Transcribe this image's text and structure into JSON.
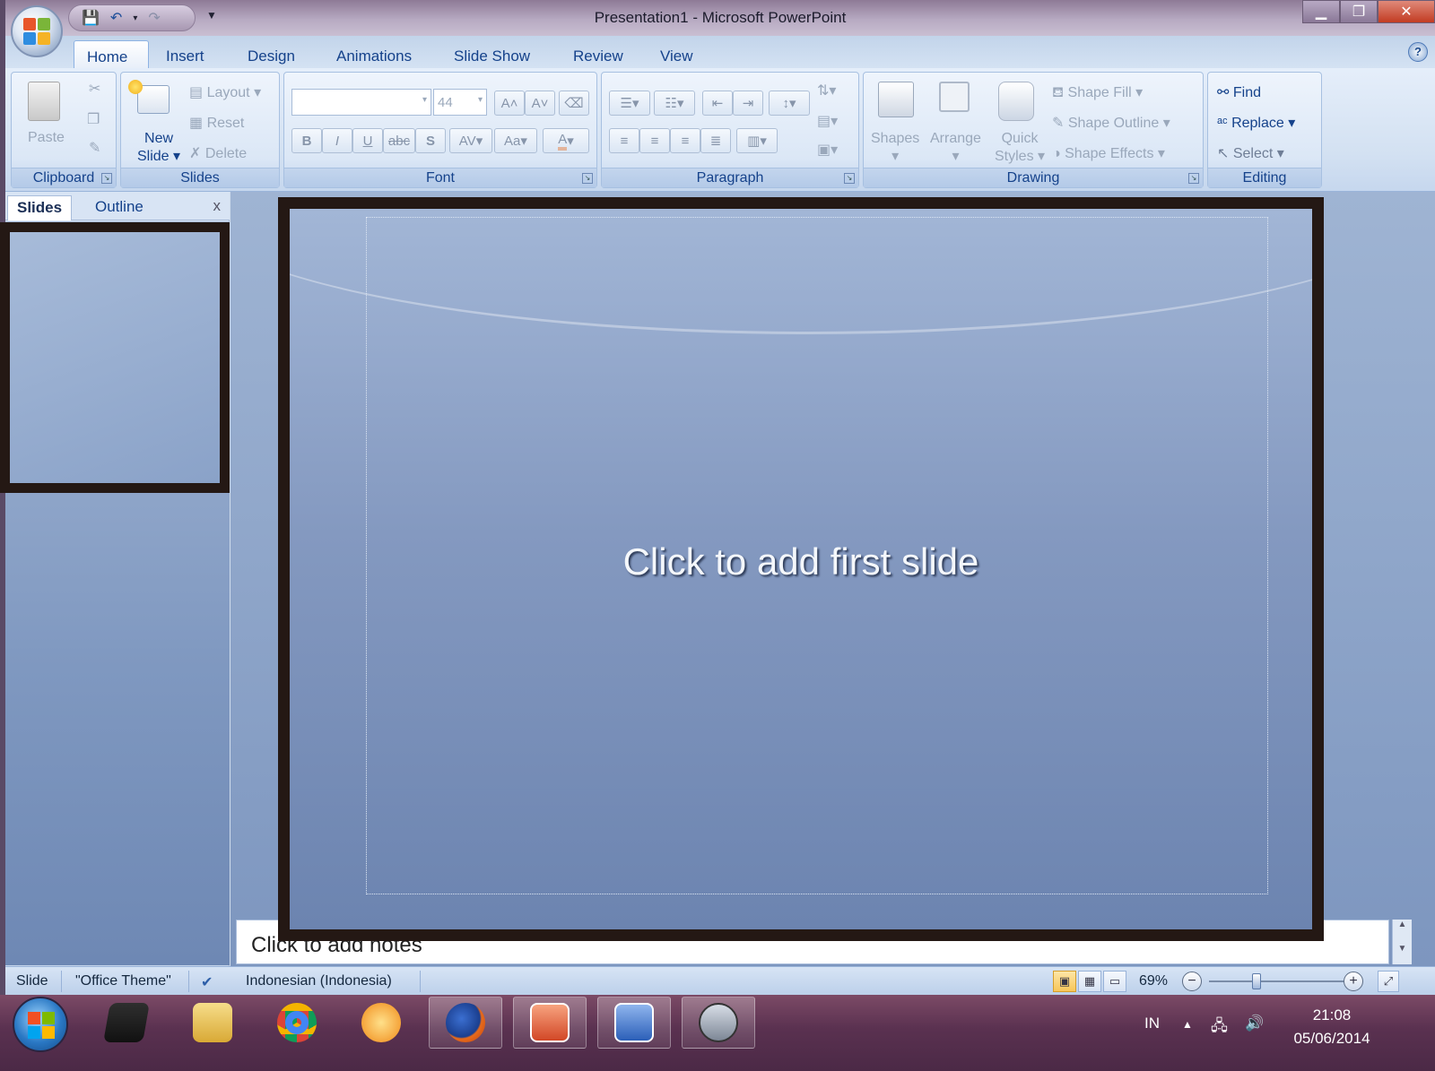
{
  "window": {
    "title": "Presentation1 - Microsoft PowerPoint",
    "controls": {
      "minimize": "▁",
      "restore": "❐",
      "close": "✕"
    }
  },
  "ribbon": {
    "tabs": [
      "Home",
      "Insert",
      "Design",
      "Animations",
      "Slide Show",
      "Review",
      "View"
    ],
    "active_tab": "Home",
    "help": "?",
    "groups": {
      "clipboard": {
        "label": "Clipboard",
        "paste": "Paste"
      },
      "slides": {
        "label": "Slides",
        "new_slide_line1": "New",
        "new_slide_line2": "Slide",
        "layout": "Layout",
        "reset": "Reset",
        "delete": "Delete"
      },
      "font": {
        "label": "Font",
        "font_name": "",
        "font_size": "44",
        "bold": "B",
        "italic": "I",
        "underline": "U",
        "strike": "abc",
        "shadow": "S",
        "spacing": "AV",
        "case": "Aa",
        "grow": "A",
        "shrink": "A",
        "color": "A"
      },
      "paragraph": {
        "label": "Paragraph"
      },
      "drawing": {
        "label": "Drawing",
        "shapes": "Shapes",
        "arrange": "Arrange",
        "quick_styles_line1": "Quick",
        "quick_styles_line2": "Styles",
        "shape_fill": "Shape Fill",
        "shape_outline": "Shape Outline",
        "shape_effects": "Shape Effects"
      },
      "editing": {
        "label": "Editing",
        "find": "Find",
        "replace": "Replace",
        "select": "Select"
      }
    }
  },
  "left_pane": {
    "tabs": [
      "Slides",
      "Outline"
    ],
    "active_tab": "Slides",
    "close": "x"
  },
  "slide": {
    "placeholder_text": "Click to add first slide"
  },
  "notes": {
    "placeholder": "Click to add notes"
  },
  "status_bar": {
    "slide": "Slide",
    "theme": "\"Office Theme\"",
    "language": "Indonesian (Indonesia)",
    "zoom": "69%",
    "zoom_level_percent": 69
  },
  "taskbar": {
    "apps": [
      "winamp",
      "file-explorer",
      "chrome",
      "garena",
      "firefox",
      "powerpoint",
      "word",
      "inkscape"
    ],
    "language": "IN",
    "time": "21:08",
    "date": "05/06/2014"
  },
  "colors": {
    "accent_text": "#15428b",
    "annotation_box": "#241814",
    "taskbar": "#5a3150"
  }
}
